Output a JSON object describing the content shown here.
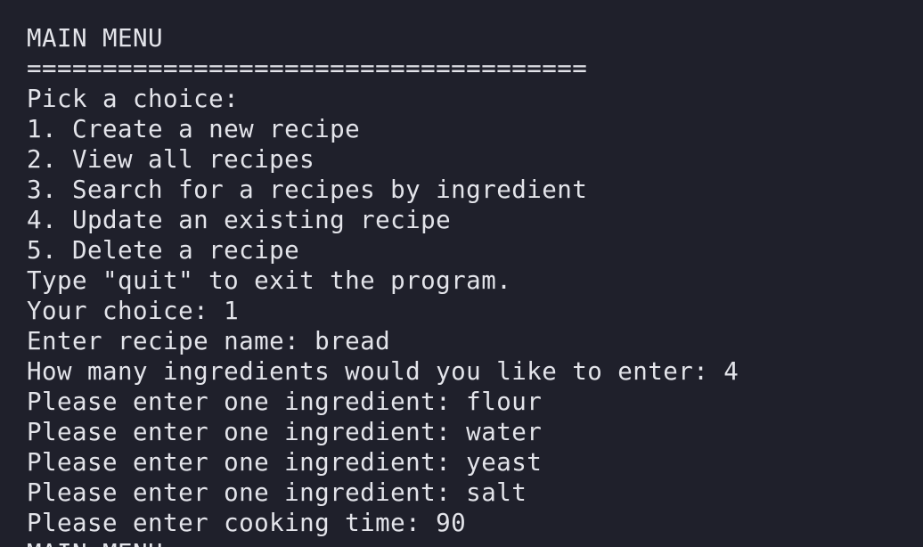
{
  "terminal": {
    "lines": [
      "MAIN MENU",
      "=====================================",
      "Pick a choice:",
      "1. Create a new recipe",
      "2. View all recipes",
      "3. Search for a recipes by ingredient",
      "4. Update an existing recipe",
      "5. Delete a recipe",
      "Type \"quit\" to exit the program.",
      "Your choice: 1",
      "Enter recipe name: bread",
      "How many ingredients would you like to enter: 4",
      "Please enter one ingredient: flour",
      "Please enter one ingredient: water",
      "Please enter one ingredient: yeast",
      "Please enter one ingredient: salt",
      "Please enter cooking time: 90",
      "MAIN MENU"
    ]
  }
}
